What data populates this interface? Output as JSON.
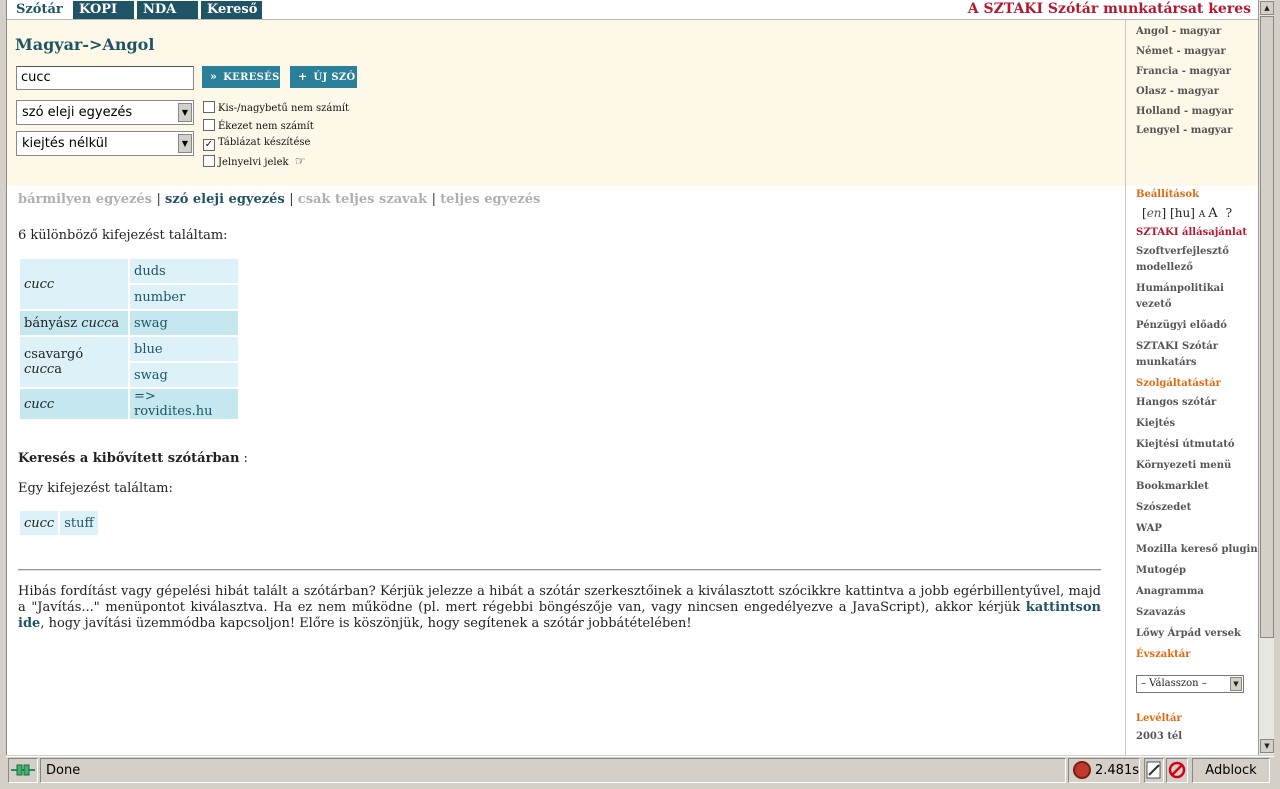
{
  "nav": {
    "tabs": [
      "Szótár",
      "KOPI",
      "NDA",
      "Kereső"
    ],
    "recruit": "A SZTAKI Szótár munkatársat keres"
  },
  "search": {
    "direction": "Magyar->Angol",
    "query": "cucc",
    "search_button": "KERESÉS",
    "new_word_button": "ÚJ SZÓ",
    "match_select": "szó eleji egyezés",
    "pron_select": "kiejtés nélkül",
    "options": [
      {
        "label": "Kis-/nagybetű nem számít",
        "checked": false
      },
      {
        "label": "Ékezet nem számít",
        "checked": false
      },
      {
        "label": "Táblázat készítése",
        "checked": true
      },
      {
        "label": "Jelnyelvi jelek",
        "checked": false
      }
    ]
  },
  "modes": {
    "any": "bármilyen egyezés",
    "prefix": "szó eleji egyezés",
    "whole_words": "csak teljes szavak",
    "exact": "teljes egyezés"
  },
  "results": {
    "summary": "6 különböző kifejezést találtam:",
    "rows": [
      {
        "hu_pre": "",
        "hu_em": "cucc",
        "hu_post": "",
        "en": [
          "duds",
          "number"
        ]
      },
      {
        "hu_pre": "bányász ",
        "hu_em": "cucc",
        "hu_post": "a",
        "en": [
          "swag"
        ]
      },
      {
        "hu_pre": "csavargó ",
        "hu_em": "cucc",
        "hu_post": "a",
        "en": [
          "blue",
          "swag"
        ]
      },
      {
        "hu_pre": "",
        "hu_em": "cucc",
        "hu_post": "",
        "en": [
          "=> rovidites.hu"
        ]
      }
    ]
  },
  "extended": {
    "title": "Keresés a kibővített szótárban",
    "title_suffix": " :",
    "summary": "Egy kifejezést találtam:",
    "hu": "cucc",
    "en": "stuff"
  },
  "footnote": {
    "part1": "Hibás fordítást vagy gépelési hibát talált a szótárban? Kérjük jelezze a hibát a szótár szerkesztőinek a kiválasztott szócikkre kattintva a jobb egérbillentyűvel, majd a \"Javítás...\" menüpontot kiválasztva. Ha ez nem működne (pl. mert régebbi böngészője van, vagy nincsen engedélyezve a JavaScript), akkor kérjük ",
    "link": "kattintson ide",
    "part2": ", hogy javítási üzemmódba kapcsoljon! Előre is köszönjük, hogy segítenek a szótár jobbátételében!"
  },
  "sidebar": {
    "languages": [
      "Angol - magyar",
      "Német - magyar",
      "Francia - magyar",
      "Olasz - magyar",
      "Holland - magyar",
      "Lengyel - magyar"
    ],
    "settings_head": "Beállítások",
    "settings_tools": {
      "en": "en",
      "hu": "hu",
      "small_a": "A",
      "big_a": "A",
      "help": "?"
    },
    "jobs_head": "SZTAKI állásajánlat",
    "jobs": [
      "Szoftverfejlesztő",
      "modellező",
      "Humánpolitikai",
      "vezető",
      "Pénzügyi előadó",
      "SZTAKI Szótár",
      "munkatárs"
    ],
    "services_head": "Szolgáltatástár",
    "services": [
      "Hangos szótár",
      "Kiejtés",
      "Kiejtési útmutató",
      "Környezeti menü",
      "Bookmarklet",
      "Szószedet",
      "WAP",
      "Mozilla kereső plugin",
      "Mutogép",
      "Anagramma",
      "Szavazás",
      "Lőwy Árpád versek"
    ],
    "season_head": "Évszaktár",
    "season_select": "– Válasszon –",
    "archive_head": "Levéltár",
    "archive_item": "2003 tél"
  },
  "statusbar": {
    "text": "Done",
    "time": "2.481s",
    "adblock": "Adblock"
  }
}
